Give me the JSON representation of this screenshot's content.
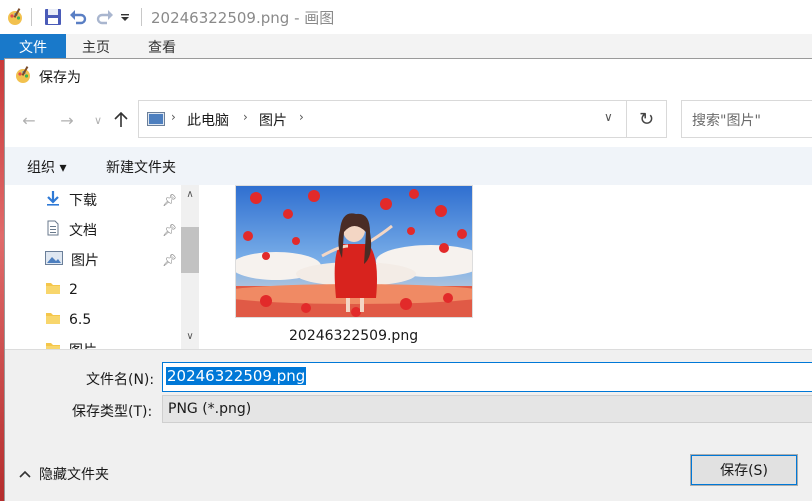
{
  "app": {
    "title": "20246322509.png - 画图",
    "ribbon_tabs": [
      "文件",
      "主页",
      "查看"
    ]
  },
  "quick_access": {
    "icons": [
      "paint-app-icon",
      "save-icon",
      "undo-icon",
      "redo-icon",
      "customize-dropdown-icon"
    ]
  },
  "dialog": {
    "title": "保存为",
    "breadcrumb": [
      "此电脑",
      "图片"
    ],
    "search_placeholder": "搜索\"图片\"",
    "toolbar": {
      "organize": "组织 ▾",
      "new_folder": "新建文件夹"
    },
    "tree": [
      {
        "label": "下载",
        "icon": "download-arrow-icon",
        "pinned": true
      },
      {
        "label": "文档",
        "icon": "document-icon",
        "pinned": true
      },
      {
        "label": "图片",
        "icon": "pictures-icon",
        "pinned": true
      },
      {
        "label": "2",
        "icon": "folder-icon",
        "pinned": false
      },
      {
        "label": "6.5",
        "icon": "folder-icon",
        "pinned": false
      },
      {
        "label": "图片",
        "icon": "folder-icon",
        "pinned": false
      }
    ],
    "files": [
      {
        "name": "20246322509.png"
      }
    ],
    "form": {
      "filename_label": "文件名(N):",
      "filename_value": "20246322509.png",
      "filetype_label": "保存类型(T):",
      "filetype_value": "PNG (*.png)",
      "hide_folders": "隐藏文件夹",
      "save_button": "保存(S)"
    }
  },
  "colors": {
    "accent": "#0078d7",
    "ribbon_file": "#1979ca",
    "toolbar_bg": "#f0f4f9",
    "form_bg": "#f0f0f0"
  }
}
